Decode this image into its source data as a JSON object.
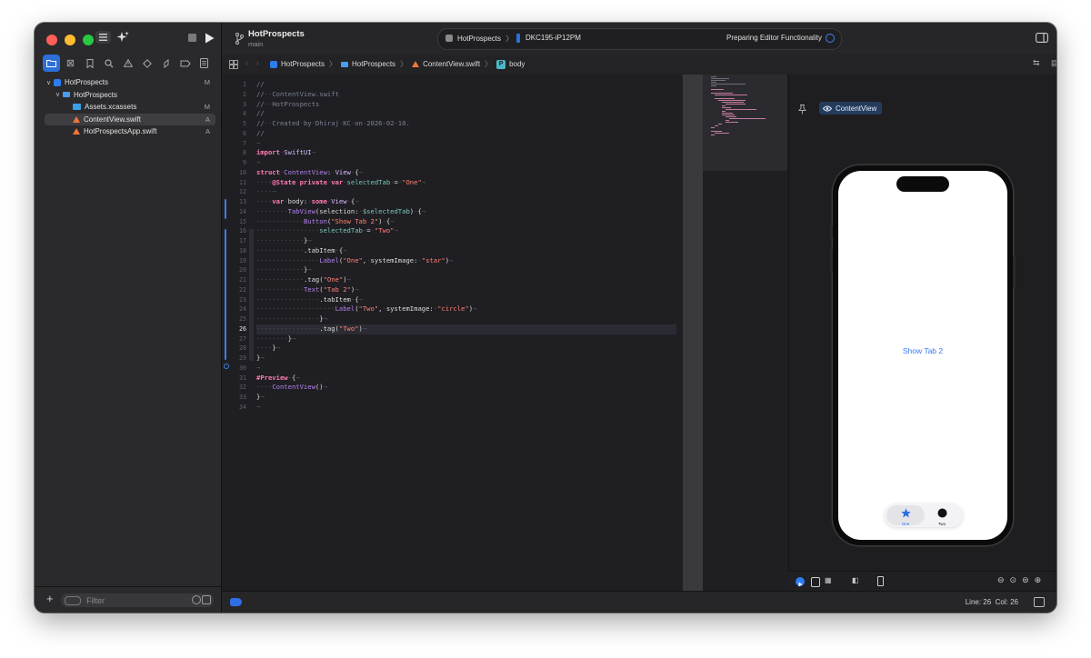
{
  "project": {
    "name": "HotProspects",
    "branch": "main"
  },
  "toolbar": {
    "scheme": "HotProspects",
    "device": "DKC195-iP12PM",
    "activity": "Preparing Editor Functionality"
  },
  "navigator": {
    "items": [
      {
        "label": "HotProspects",
        "badge": "M"
      },
      {
        "label": "HotProspects",
        "badge": ""
      },
      {
        "label": "Assets.xcassets",
        "badge": "M"
      },
      {
        "label": "ContentView.swift",
        "badge": "A"
      },
      {
        "label": "HotProspectsApp.swift",
        "badge": "A"
      }
    ],
    "filter_placeholder": "Filter"
  },
  "jumpbar": {
    "items": [
      "HotProspects",
      "HotProspects",
      "ContentView.swift",
      "body"
    ]
  },
  "editor": {
    "lines": [
      "//",
      "//  ContentView.swift",
      "//  HotProspects",
      "//",
      "//  Created by Dhiraj KC on 2026-02-10.",
      "//",
      "",
      "import SwiftUI",
      "",
      "struct ContentView: View {",
      "    @State private var selectedTab = \"One\"",
      "    ",
      "    var body: some View {",
      "        TabView(selection: $selectedTab) {",
      "            Button(\"Show Tab 2\") {",
      "                selectedTab = \"Two\"",
      "            }",
      "            .tabItem {",
      "                Label(\"One\", systemImage: \"star\")",
      "            }",
      "            .tag(\"One\")",
      "            Text(\"Tab 2\")",
      "                .tabItem {",
      "                    Label(\"Two\", systemImage: \"circle\")",
      "                }",
      "                .tag(\"Two\")",
      "        }",
      "    }",
      "}",
      "",
      "#Preview {",
      "    ContentView()",
      "}",
      ""
    ],
    "current_line": 26
  },
  "canvas": {
    "preview_tab": "ContentView",
    "button_label": "Show Tab 2",
    "tabs": [
      {
        "label": "One",
        "icon": "star-fill-icon"
      },
      {
        "label": "Two",
        "icon": "circle-fill-icon"
      }
    ]
  },
  "status": {
    "position": "Line: 26  Col: 26"
  },
  "colors": {
    "accent": "#2d6fd8",
    "keyword": "#ff7ab2",
    "string": "#ff8170",
    "comment": "#7a8190",
    "type": "#dabaff",
    "preview_link": "#3478f6"
  }
}
